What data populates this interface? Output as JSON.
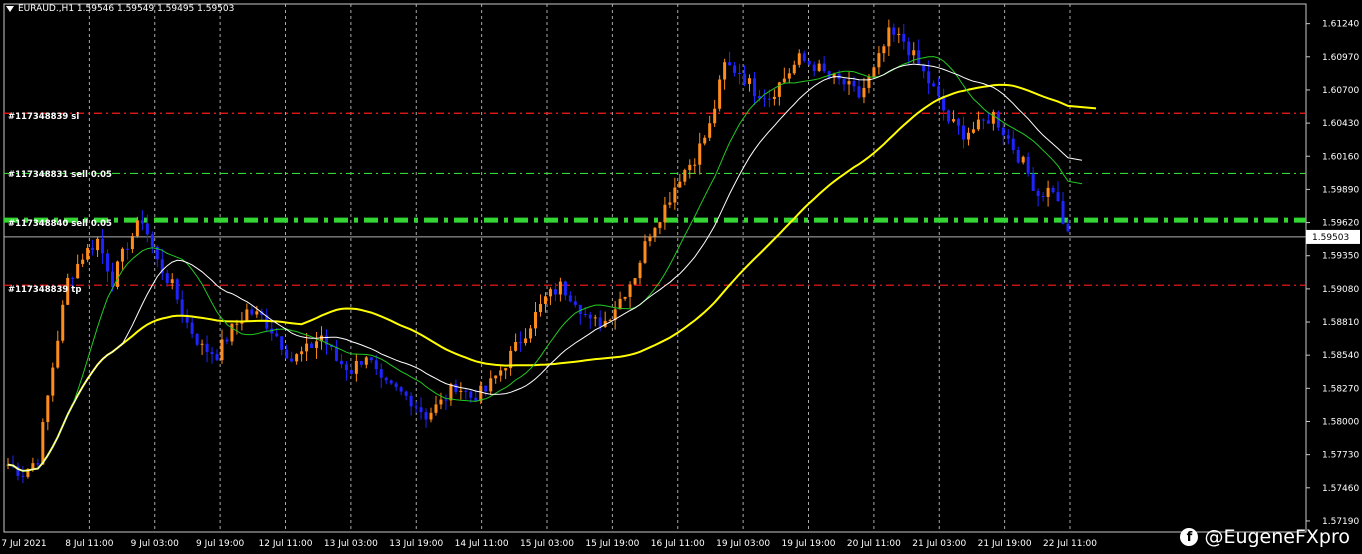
{
  "header": {
    "symbol_line": "EURAUD.,H1  1.59546 1.59549 1.59495 1.59503"
  },
  "current_price_label": "1.59503",
  "order_labels": {
    "sl": "#117348839 sl",
    "sell": "#117348831 sell 0.05",
    "sell_cluster": "#117348840 sell 0.05",
    "tp": "#117348839 tp"
  },
  "watermark": {
    "text": "@EugeneFXpro",
    "icon": "brand-f-icon"
  },
  "chart_data": {
    "type": "candlestick",
    "title": "",
    "xlabel": "",
    "ylabel": "",
    "ylim": [
      1.571,
      1.614
    ],
    "y_ticks": [
      1.6124,
      1.6097,
      1.607,
      1.6043,
      1.6016,
      1.5989,
      1.5962,
      1.5935,
      1.5908,
      1.5881,
      1.5854,
      1.5827,
      1.58,
      1.5773,
      1.5746,
      1.5719
    ],
    "x_ticks": [
      "7 Jul 2021",
      "8 Jul 11:00",
      "9 Jul 03:00",
      "9 Jul 19:00",
      "12 Jul 11:00",
      "13 Jul 03:00",
      "13 Jul 19:00",
      "14 Jul 11:00",
      "15 Jul 03:00",
      "15 Jul 19:00",
      "16 Jul 11:00",
      "19 Jul 03:00",
      "19 Jul 19:00",
      "20 Jul 11:00",
      "21 Jul 03:00",
      "21 Jul 19:00",
      "22 Jul 11:00"
    ],
    "grid": true,
    "colors": {
      "bull": "#ff8c1a",
      "bear": "#1f24ff",
      "ma_slow": "#ffff00",
      "ma_mid": "#22c922",
      "ma_fast": "#ffffff",
      "sl": "#ff1a1a",
      "order": "#33d633",
      "grid": "#c8c8c8",
      "bid_line": "#b0b0b0"
    },
    "horizontal_levels": [
      {
        "name": "sl",
        "price": 1.6051,
        "style": "dash-dot",
        "color": "#ff1a1a"
      },
      {
        "name": "sell",
        "price": 1.6002,
        "style": "dash-dot",
        "color": "#33d633"
      },
      {
        "name": "sell-cluster",
        "price": 1.5964,
        "style": "thick-dash-dot",
        "color": "#33d633"
      },
      {
        "name": "tp",
        "price": 1.5911,
        "style": "dash-dot",
        "color": "#ff1a1a"
      },
      {
        "name": "bid",
        "price": 1.59503,
        "style": "solid",
        "color": "#b0b0b0"
      }
    ],
    "price_waypoints": [
      [
        0,
        1.5765
      ],
      [
        3,
        1.5758
      ],
      [
        6,
        1.577
      ],
      [
        9,
        1.5845
      ],
      [
        12,
        1.5915
      ],
      [
        15,
        1.5935
      ],
      [
        18,
        1.5948
      ],
      [
        21,
        1.5915
      ],
      [
        24,
        1.5945
      ],
      [
        27,
        1.5965
      ],
      [
        30,
        1.593
      ],
      [
        33,
        1.591
      ],
      [
        36,
        1.588
      ],
      [
        39,
        1.586
      ],
      [
        42,
        1.5855
      ],
      [
        45,
        1.5875
      ],
      [
        48,
        1.589
      ],
      [
        51,
        1.5885
      ],
      [
        54,
        1.587
      ],
      [
        57,
        1.585
      ],
      [
        60,
        1.5858
      ],
      [
        63,
        1.587
      ],
      [
        66,
        1.585
      ],
      [
        69,
        1.5842
      ],
      [
        72,
        1.5855
      ],
      [
        75,
        1.583
      ],
      [
        78,
        1.5825
      ],
      [
        81,
        1.5818
      ],
      [
        84,
        1.5805
      ],
      [
        87,
        1.5815
      ],
      [
        90,
        1.583
      ],
      [
        93,
        1.582
      ],
      [
        96,
        1.5825
      ],
      [
        99,
        1.5842
      ],
      [
        102,
        1.586
      ],
      [
        105,
        1.588
      ],
      [
        108,
        1.59
      ],
      [
        111,
        1.591
      ],
      [
        114,
        1.59
      ],
      [
        117,
        1.588
      ],
      [
        120,
        1.5882
      ],
      [
        123,
        1.59
      ],
      [
        126,
        1.592
      ],
      [
        129,
        1.5955
      ],
      [
        132,
        1.5975
      ],
      [
        135,
        1.6
      ],
      [
        138,
        1.6015
      ],
      [
        141,
        1.604
      ],
      [
        144,
        1.609
      ],
      [
        147,
        1.6085
      ],
      [
        150,
        1.607
      ],
      [
        153,
        1.6065
      ],
      [
        156,
        1.608
      ],
      [
        159,
        1.6095
      ],
      [
        162,
        1.609
      ],
      [
        165,
        1.608
      ],
      [
        168,
        1.6075
      ],
      [
        171,
        1.6065
      ],
      [
        174,
        1.6085
      ],
      [
        177,
        1.6115
      ],
      [
        180,
        1.611
      ],
      [
        183,
        1.609
      ],
      [
        186,
        1.607
      ],
      [
        189,
        1.6045
      ],
      [
        192,
        1.6035
      ],
      [
        195,
        1.604
      ],
      [
        198,
        1.605
      ],
      [
        201,
        1.603
      ],
      [
        204,
        1.601
      ],
      [
        207,
        1.5985
      ],
      [
        210,
        1.599
      ],
      [
        213,
        1.595
      ]
    ],
    "series": [
      {
        "name": "",
        "role": "ma_slow",
        "values_note": "computed from price path"
      },
      {
        "name": "",
        "role": "ma_mid"
      },
      {
        "name": "",
        "role": "ma_fast"
      }
    ]
  }
}
